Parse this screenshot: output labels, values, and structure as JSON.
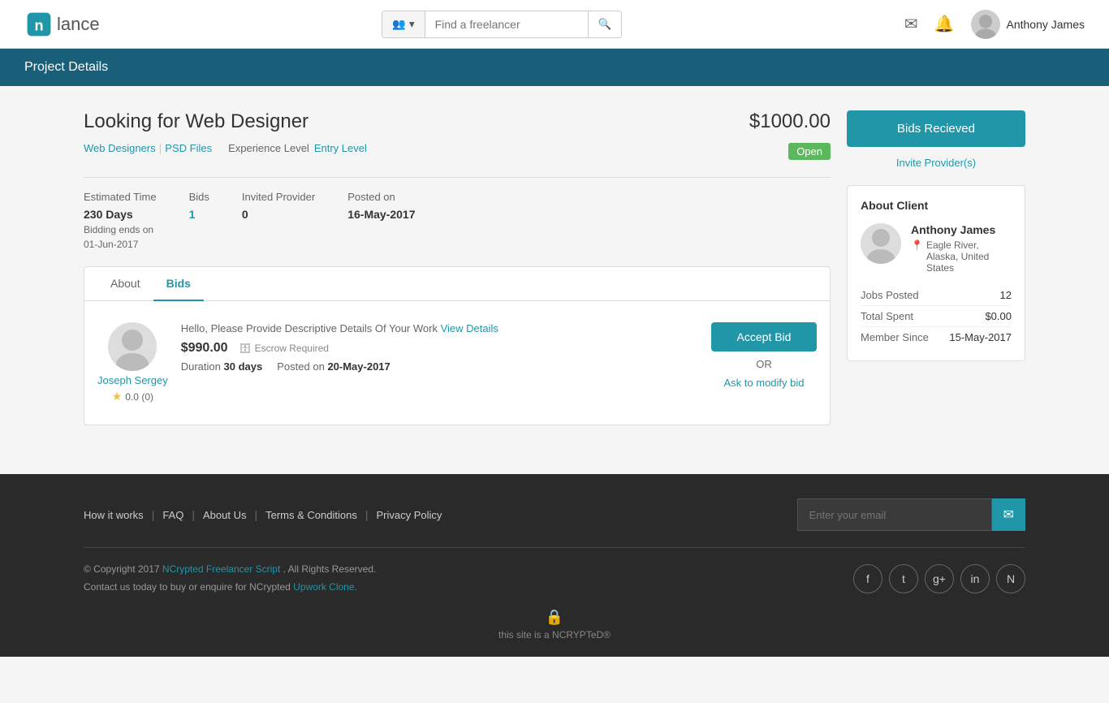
{
  "header": {
    "logo_text": "lance",
    "search_placeholder": "Find a freelancer",
    "user_name": "Anthony James"
  },
  "banner": {
    "title": "Project Details"
  },
  "project": {
    "title": "Looking for Web Designer",
    "budget": "$1000.00",
    "tags": [
      "Web Designers",
      "PSD Files"
    ],
    "experience_label": "Experience Level",
    "experience_value": "Entry Level",
    "status": "Open",
    "stats": {
      "estimated_time_label": "Estimated Time",
      "estimated_time_value": "230 Days",
      "bidding_ends_label": "Bidding ends on",
      "bidding_ends_value": "01-Jun-2017",
      "bids_label": "Bids",
      "bids_value": "1",
      "invited_provider_label": "Invited Provider",
      "invited_provider_value": "0",
      "posted_on_label": "Posted on",
      "posted_on_value": "16-May-2017"
    }
  },
  "tabs": {
    "about_label": "About",
    "bids_label": "Bids"
  },
  "bid": {
    "user_name": "Joseph Sergey",
    "rating": "0.0",
    "rating_count": "(0)",
    "message": "Hello, Please Provide Descriptive Details Of Your Work",
    "view_details_link": "View Details",
    "amount": "$990.00",
    "escrow_label": "Escrow Required",
    "duration_label": "Duration",
    "duration_value": "30 days",
    "posted_on_label": "Posted on",
    "posted_on_value": "20-May-2017",
    "accept_label": "Accept Bid",
    "or_text": "OR",
    "modify_label": "Ask to modify bid"
  },
  "sidebar": {
    "bids_received_label": "Bids Recieved",
    "invite_label": "Invite Provider(s)"
  },
  "about_client": {
    "title": "About Client",
    "name": "Anthony James",
    "location": "Eagle River, Alaska, United States",
    "jobs_posted_label": "Jobs Posted",
    "jobs_posted_value": "12",
    "total_spent_label": "Total Spent",
    "total_spent_value": "$0.00",
    "member_since_label": "Member Since",
    "member_since_value": "15-May-2017"
  },
  "footer": {
    "nav": [
      "How it works",
      "FAQ",
      "About Us",
      "Terms & Conditions",
      "Privacy Policy"
    ],
    "email_placeholder": "Enter your email",
    "copyright": "© Copyright 2017",
    "ncrypted_link": "NCrypted Freelancer Script",
    "rights": ". All Rights Reserved.",
    "contact_text": "Contact us today to buy or enquire for NCrypted",
    "upwork_link": "Upwork Clone.",
    "social": [
      "f",
      "t",
      "g+",
      "in",
      "N"
    ]
  }
}
